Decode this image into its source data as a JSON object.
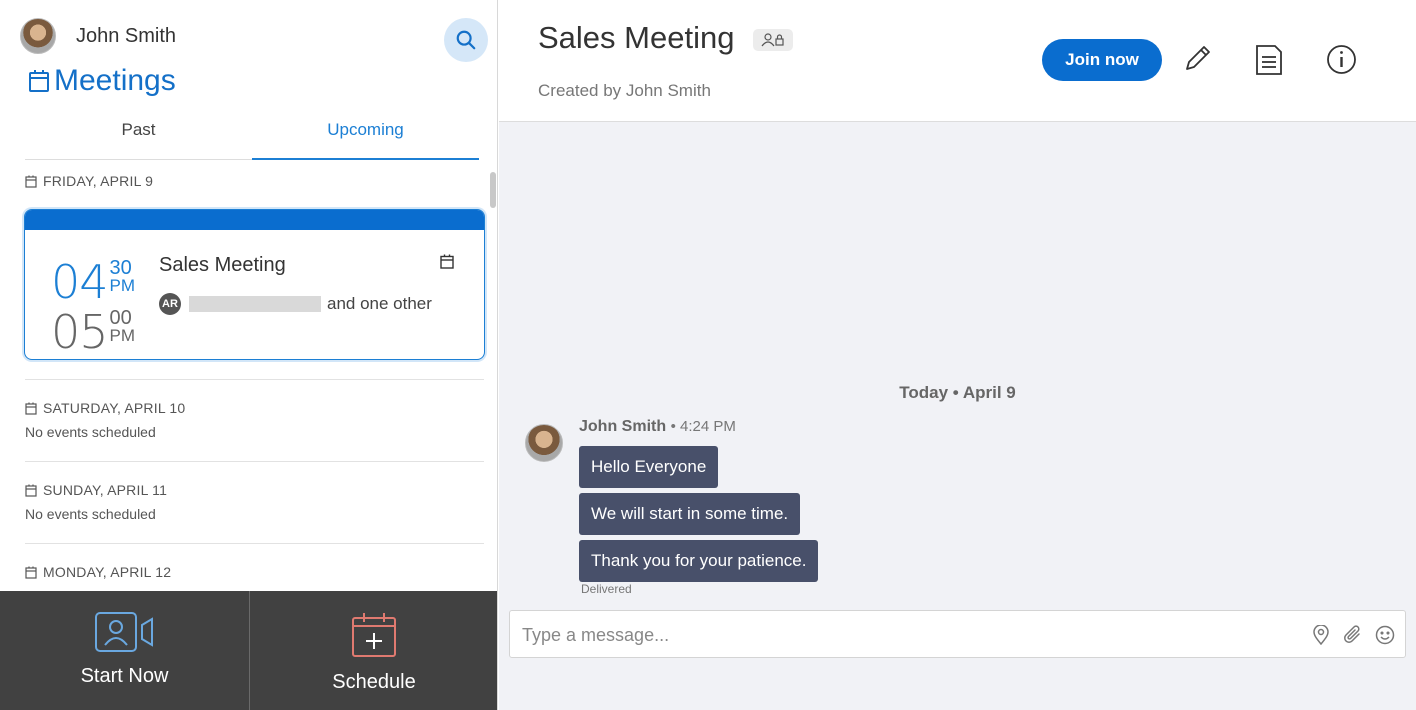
{
  "user": {
    "name": "John Smith"
  },
  "sidebar": {
    "title": "Meetings",
    "tabs": [
      {
        "label": "Past"
      },
      {
        "label": "Upcoming"
      }
    ],
    "days": [
      {
        "label": "FRIDAY, APRIL 9",
        "meeting": {
          "start_hour": "04",
          "start_min": "30",
          "start_period": "PM",
          "end_hour": "05",
          "end_min": "00",
          "end_period": "PM",
          "title": "Sales Meeting",
          "attendee_initials": "AR",
          "attendee_other": "and one other"
        }
      },
      {
        "label": "SATURDAY, APRIL 10",
        "empty": "No events scheduled"
      },
      {
        "label": "SUNDAY, APRIL 11",
        "empty": "No events scheduled"
      },
      {
        "label": "MONDAY, APRIL 12"
      }
    ],
    "bottom": {
      "start_now": "Start Now",
      "schedule": "Schedule"
    }
  },
  "meeting": {
    "title": "Sales Meeting",
    "created_by": "Created by John Smith",
    "join_label": "Join now"
  },
  "chat": {
    "day_separator": "Today • April 9",
    "sender": "John Smith",
    "time": "• 4:24 PM",
    "messages": [
      "Hello Everyone",
      "We will start in some time.",
      "Thank you for your patience."
    ],
    "status": "Delivered",
    "composer_placeholder": "Type a message..."
  },
  "colors": {
    "accent": "#1c7fd4",
    "join_button": "#0a6dcf",
    "bubble": "#48506a",
    "bottom_bar": "#414141",
    "chat_bg": "#f1f2f6"
  },
  "icons": [
    "search-icon",
    "calendar-icon",
    "video-person-icon",
    "calendar-add-icon",
    "people-lock-icon",
    "pencil-icon",
    "document-icon",
    "info-icon",
    "location-pin-icon",
    "paperclip-icon",
    "smiley-icon"
  ]
}
